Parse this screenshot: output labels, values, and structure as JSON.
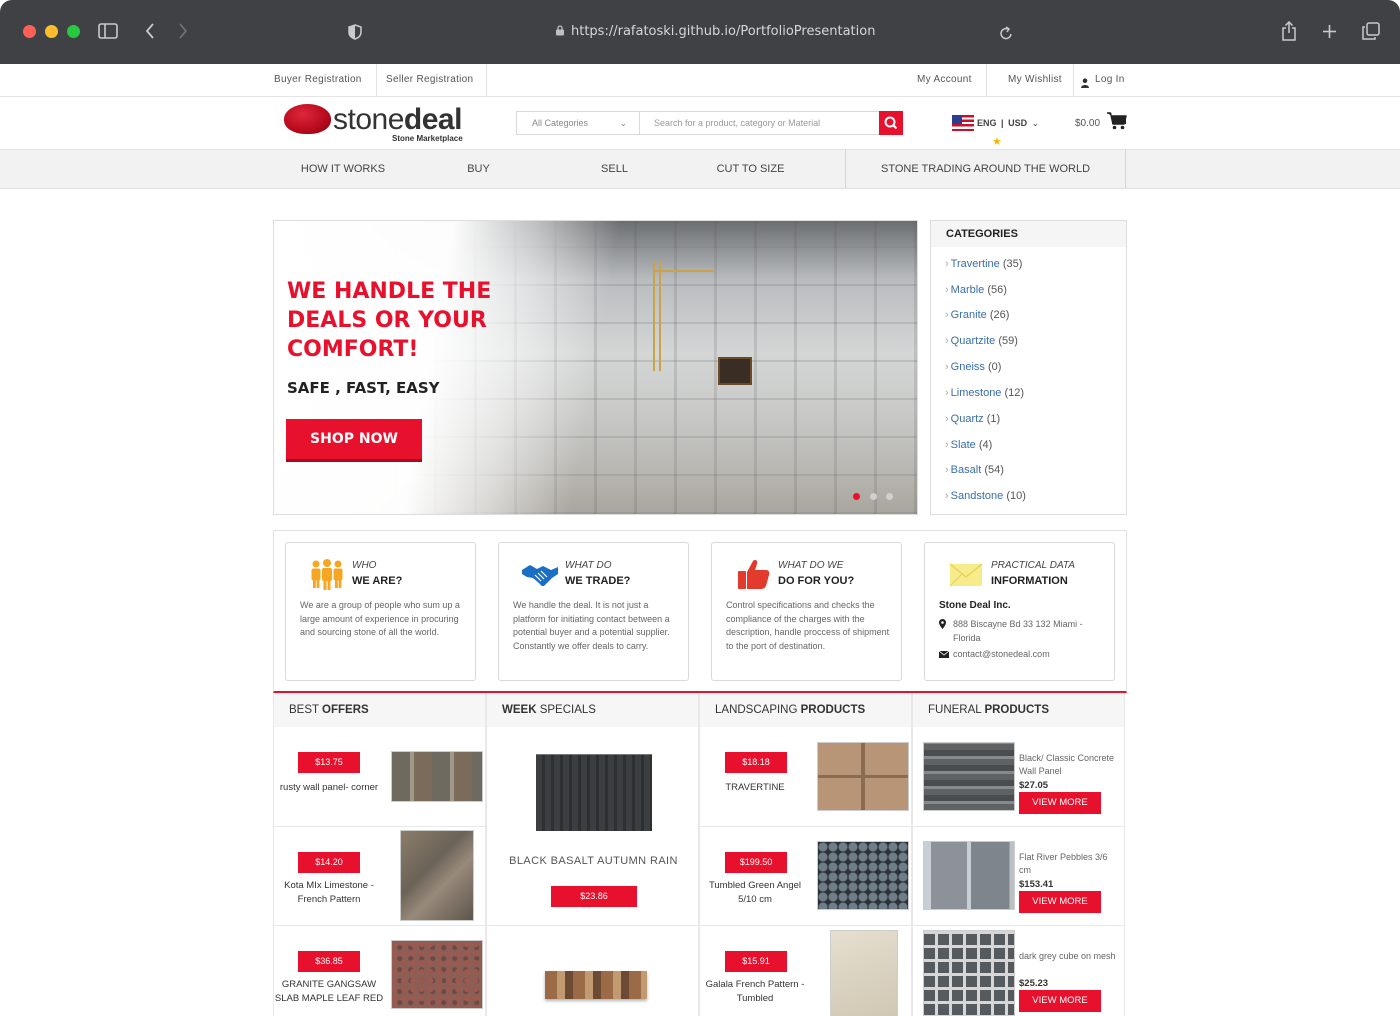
{
  "browser": {
    "url": "https://rafatoski.github.io/PortfolioPresentation"
  },
  "toplinks": {
    "buyer": "Buyer Registration",
    "seller": "Seller Registration",
    "account": "My Account",
    "wishlist": "My Wishlist",
    "login": "Log In"
  },
  "header": {
    "logo_part1": "stone",
    "logo_part2": "deal",
    "logo_sub": "Stone Marketplace",
    "category_select": "All Categories",
    "search_placeholder": "Search for a product, category or Material",
    "lang": "ENG",
    "currency": "USD",
    "cart_total": "$0.00"
  },
  "nav": {
    "items": [
      "HOW IT WORKS",
      "BUY",
      "SELL",
      "CUT TO SIZE",
      "STONE TRADING AROUND THE WORLD"
    ]
  },
  "hero": {
    "heading": "WE HANDLE THE DEALS OR YOUR COMFORT!",
    "subheading": "SAFE , FAST, EASY",
    "cta": "SHOP NOW"
  },
  "categories": {
    "title": "CATEGORIES",
    "items": [
      {
        "name": "Travertine",
        "count": "(35)"
      },
      {
        "name": "Marble",
        "count": "(56)"
      },
      {
        "name": "Granite",
        "count": "(26)"
      },
      {
        "name": "Quartzite",
        "count": "(59)"
      },
      {
        "name": "Gneiss",
        "count": "(0)"
      },
      {
        "name": "Limestone",
        "count": "(12)"
      },
      {
        "name": "Quartz",
        "count": "(1)"
      },
      {
        "name": "Slate",
        "count": "(4)"
      },
      {
        "name": "Basalt",
        "count": "(54)"
      },
      {
        "name": "Sandstone",
        "count": "(10)"
      }
    ]
  },
  "info": {
    "who": {
      "t1": "WHO",
      "t2": "WE ARE?",
      "text": "We are a group of people who sum up a large amount of experience in procuring and sourcing stone of all the world."
    },
    "trade": {
      "t1": "WHAT DO",
      "t2": "WE TRADE?",
      "text": "We handle the deal. It is not just a platform for initiating contact between a potential buyer and a potential supplier. Constantly we offer deals to carry."
    },
    "doforyou": {
      "t1": "WHAT DO WE",
      "t2": "DO FOR YOU?",
      "text": "Control specifications and checks the compliance of the charges with the description, handle proccess of shipment to the port of destination."
    },
    "practical": {
      "t1": "PRACTICAL DATA",
      "t2": "INFORMATION",
      "company": "Stone Deal Inc.",
      "address": "888 Biscayne Bd 33 132 Miami - Florida",
      "email": "contact@stonedeal.com"
    }
  },
  "columns": {
    "best": {
      "title_a": "BEST ",
      "title_b": "OFFERS",
      "items": [
        {
          "price": "$13.75",
          "name": "rusty wall panel- corner"
        },
        {
          "price": "$14.20",
          "name": "Kota MIx Limestone - French Pattern"
        },
        {
          "price": "$36.85",
          "name": "GRANITE GANGSAW SLAB MAPLE LEAF RED"
        }
      ]
    },
    "week": {
      "title_a": "WEEK",
      "title_b": " SPECIALS",
      "name": "BLACK BASALT AUTUMN RAIN",
      "price": "$23.86"
    },
    "landscaping": {
      "title_a": "LANDSCAPING ",
      "title_b": "PRODUCTS",
      "items": [
        {
          "price": "$18.18",
          "name": "TRAVERTINE"
        },
        {
          "price": "$199.50",
          "name": "Tumbled Green Angel 5/10 cm"
        },
        {
          "price": "$15.91",
          "name": "Galala French Pattern - Tumbled"
        }
      ]
    },
    "funeral": {
      "title_a": "FUNERAL ",
      "title_b": "PRODUCTS",
      "view_more": "VIEW MORE",
      "items": [
        {
          "name": "Black/ Classic Concrete Wall Panel",
          "price": "$27.05"
        },
        {
          "name": "Flat River Pebbles 3/6 cm",
          "price": "$153.41"
        },
        {
          "name": "dark grey cube on mesh",
          "price": "$25.23"
        }
      ]
    }
  },
  "colors": {
    "accent": "#e8112d",
    "chrome": "#3f4144"
  }
}
